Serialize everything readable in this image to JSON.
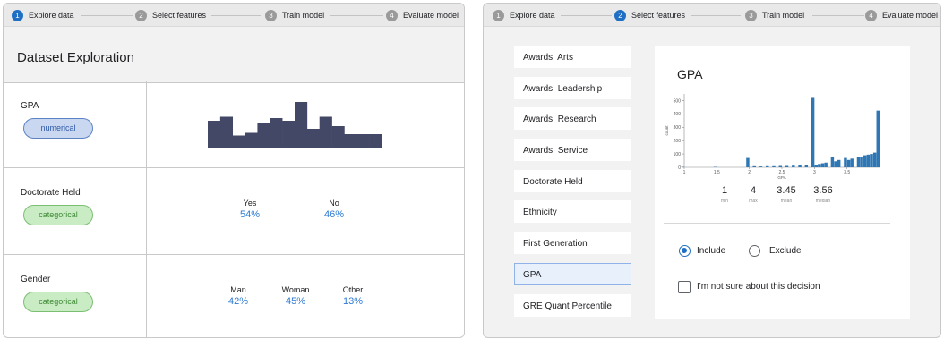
{
  "left": {
    "steps": [
      {
        "num": "1",
        "label": "Explore data",
        "active": true
      },
      {
        "num": "2",
        "label": "Select features",
        "active": false
      },
      {
        "num": "3",
        "label": "Train model",
        "active": false
      },
      {
        "num": "4",
        "label": "Evaluate model",
        "active": false
      }
    ],
    "title": "Dataset Exploration",
    "rows": [
      {
        "name": "GPA",
        "type": "numerical",
        "histogram": [
          20,
          23,
          9,
          11,
          18,
          22,
          20,
          34,
          14,
          23,
          16,
          10,
          10,
          10
        ]
      },
      {
        "name": "Doctorate Held",
        "type": "categorical",
        "categories": [
          {
            "label": "Yes",
            "value": "54%"
          },
          {
            "label": "No",
            "value": "46%"
          }
        ]
      },
      {
        "name": "Gender",
        "type": "categorical",
        "categories": [
          {
            "label": "Man",
            "value": "42%"
          },
          {
            "label": "Woman",
            "value": "45%"
          },
          {
            "label": "Other",
            "value": "13%"
          }
        ]
      }
    ]
  },
  "right": {
    "steps": [
      {
        "num": "1",
        "label": "Explore data",
        "active": false
      },
      {
        "num": "2",
        "label": "Select features",
        "active": true
      },
      {
        "num": "3",
        "label": "Train model",
        "active": false
      },
      {
        "num": "4",
        "label": "Evaluate model",
        "active": false
      }
    ],
    "features": [
      "Awards: Arts",
      "Awards: Leadership",
      "Awards: Research",
      "Awards: Service",
      "Doctorate Held",
      "Ethnicity",
      "First Generation",
      "GPA",
      "GRE Quant Percentile"
    ],
    "selected_index": 7,
    "detail": {
      "title": "GPA",
      "stats": [
        {
          "value": "1",
          "label": "min"
        },
        {
          "value": "4",
          "label": "max"
        },
        {
          "value": "3.45",
          "label": "mean"
        },
        {
          "value": "3.56",
          "label": "median"
        }
      ],
      "include_label": "Include",
      "exclude_label": "Exclude",
      "include_selected": true,
      "unsure_label": "I'm not sure about this decision",
      "unsure_checked": false
    }
  },
  "chart_data": {
    "type": "bar",
    "xlabel": "GPA",
    "ylabel": "count",
    "xlim": [
      1,
      4
    ],
    "ylim": [
      0,
      550
    ],
    "yticks": [
      0,
      100,
      200,
      300,
      400,
      500
    ],
    "xticks": [
      1,
      1.5,
      2,
      2.5,
      3,
      3.5
    ],
    "bins": [
      {
        "x": 1.0,
        "y": 3
      },
      {
        "x": 1.5,
        "y": 3
      },
      {
        "x": 2.0,
        "y": 70
      },
      {
        "x": 2.1,
        "y": 8
      },
      {
        "x": 2.2,
        "y": 6
      },
      {
        "x": 2.3,
        "y": 8
      },
      {
        "x": 2.4,
        "y": 8
      },
      {
        "x": 2.5,
        "y": 10
      },
      {
        "x": 2.6,
        "y": 10
      },
      {
        "x": 2.7,
        "y": 12
      },
      {
        "x": 2.8,
        "y": 14
      },
      {
        "x": 2.9,
        "y": 16
      },
      {
        "x": 3.0,
        "y": 520
      },
      {
        "x": 3.05,
        "y": 20
      },
      {
        "x": 3.1,
        "y": 25
      },
      {
        "x": 3.15,
        "y": 30
      },
      {
        "x": 3.2,
        "y": 35
      },
      {
        "x": 3.3,
        "y": 80
      },
      {
        "x": 3.35,
        "y": 45
      },
      {
        "x": 3.4,
        "y": 55
      },
      {
        "x": 3.5,
        "y": 70
      },
      {
        "x": 3.55,
        "y": 55
      },
      {
        "x": 3.6,
        "y": 65
      },
      {
        "x": 3.7,
        "y": 75
      },
      {
        "x": 3.75,
        "y": 80
      },
      {
        "x": 3.8,
        "y": 90
      },
      {
        "x": 3.85,
        "y": 95
      },
      {
        "x": 3.9,
        "y": 100
      },
      {
        "x": 3.95,
        "y": 110
      },
      {
        "x": 4.0,
        "y": 425
      }
    ]
  }
}
